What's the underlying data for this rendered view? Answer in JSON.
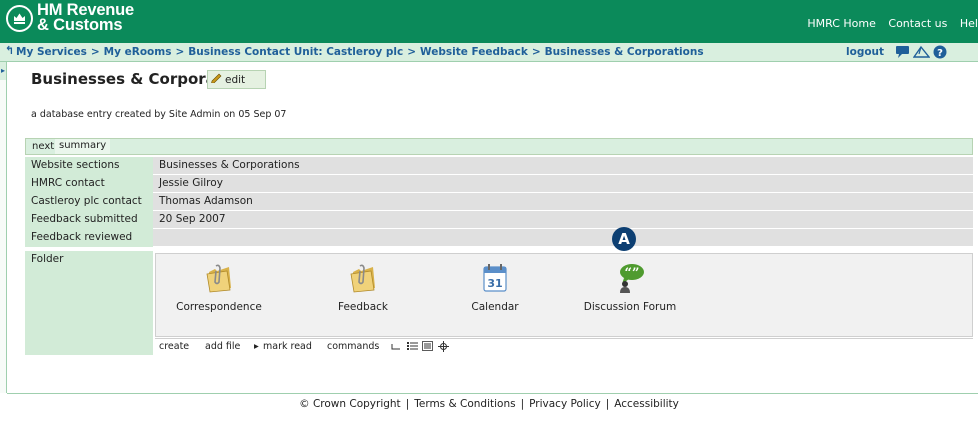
{
  "header": {
    "logo_line1": "HM Revenue",
    "logo_line2": "& Customs",
    "links": [
      "HMRC Home",
      "Contact us",
      "Hel"
    ]
  },
  "breadcrumb": {
    "items": [
      "My Services",
      "My eRooms",
      "Business Contact Unit: Castleroy plc",
      "Website Feedback",
      "Businesses & Corporations"
    ],
    "separator": ">",
    "logout": "logout"
  },
  "page": {
    "title": "Businesses & Corporations",
    "edit_label": "edit",
    "subline": "a database entry created by Site Admin on 05 Sep 07"
  },
  "tabs": {
    "next": "next",
    "summary": "summary"
  },
  "fields": [
    {
      "label": "Website sections",
      "value": "Businesses & Corporations"
    },
    {
      "label": "HMRC contact",
      "value": "Jessie Gilroy"
    },
    {
      "label": "Castleroy plc contact",
      "value": "Thomas Adamson"
    },
    {
      "label": "Feedback submitted",
      "value": "20 Sep 2007"
    },
    {
      "label": "Feedback reviewed",
      "value": ""
    }
  ],
  "folder": {
    "label": "Folder",
    "items": [
      {
        "label": "Correspondence",
        "icon": "folder-icon"
      },
      {
        "label": "Feedback",
        "icon": "folder-icon"
      },
      {
        "label": "Calendar",
        "icon": "calendar-icon"
      },
      {
        "label": "Discussion Forum",
        "icon": "discussion-icon"
      }
    ],
    "calendar_day": "31"
  },
  "commands": {
    "create": "create",
    "add_file": "add file",
    "mark_read": "mark read",
    "commands": "commands"
  },
  "annotation": {
    "badge": "A"
  },
  "footer": {
    "items": [
      "© Crown Copyright",
      "Terms & Conditions",
      "Privacy Policy",
      "Accessibility"
    ],
    "separator": "|"
  },
  "colors": {
    "brand_green": "#0b8a5a",
    "link_blue": "#1f5f99",
    "badge_navy": "#0d3f72",
    "light_green": "#d2ebd7"
  }
}
